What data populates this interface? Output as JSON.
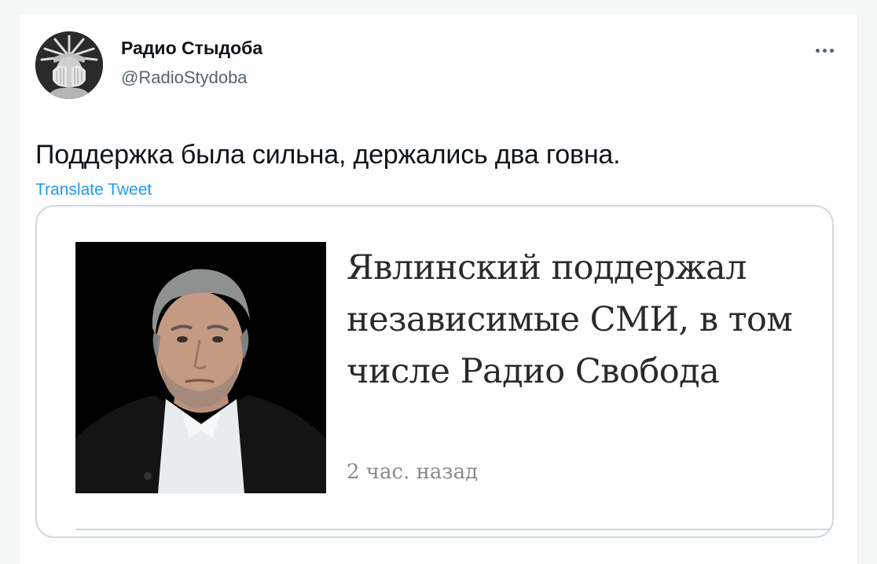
{
  "author": {
    "display_name": "Радио Стыдоба",
    "handle": "@RadioStydoba",
    "avatar_icon": "statue-of-liberty-facepalm-avatar"
  },
  "tweet": {
    "text": "Поддержка была сильна, держались два говна.",
    "translate_label": "Translate Tweet",
    "more_icon": "more-dots-icon"
  },
  "card": {
    "headline": "Явлинский поддержал независимые СМИ, в том числе Радио Свобода",
    "time_ago": "2 час. назад"
  },
  "colors": {
    "link": "#1d9bf0",
    "text_primary": "#0f1419",
    "text_secondary": "#536471",
    "card_border": "#cfd9de"
  }
}
